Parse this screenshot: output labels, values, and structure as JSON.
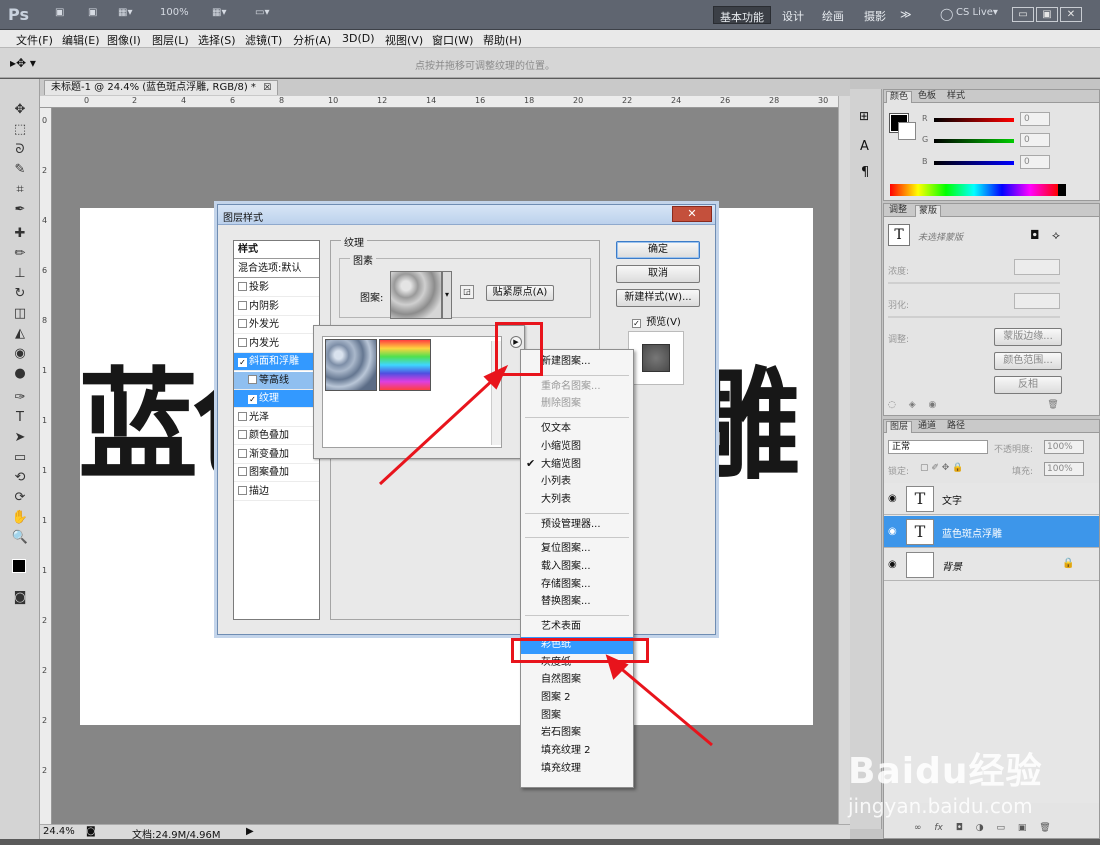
{
  "app": {
    "logo": "Ps",
    "zoom_display": "100%",
    "workspaces": [
      "基本功能",
      "设计",
      "绘画",
      "摄影",
      "≫"
    ],
    "cslive": "CS Live▾"
  },
  "menu": [
    "文件(F)",
    "编辑(E)",
    "图像(I)",
    "图层(L)",
    "选择(S)",
    "滤镜(T)",
    "分析(A)",
    "3D(D)",
    "视图(V)",
    "窗口(W)",
    "帮助(H)"
  ],
  "options_hint": "点按并拖移可调整纹理的位置。",
  "doc_tab": "未标题-1 @ 24.4% (蓝色斑点浮雕, RGB/8) *",
  "canvas_text": {
    "left": "蓝",
    "left2": "色",
    "right": "雕"
  },
  "ruler_h": [
    "0",
    "2",
    "4",
    "6",
    "8",
    "10",
    "12",
    "14",
    "16",
    "18",
    "20",
    "22",
    "24",
    "26",
    "28",
    "30"
  ],
  "ruler_v": [
    "0",
    "2",
    "4",
    "6",
    "8",
    "1",
    "1",
    "1",
    "1",
    "1",
    "2",
    "2",
    "2",
    "2"
  ],
  "status": {
    "zoom": "24.4%",
    "doc": "文档:24.9M/4.96M"
  },
  "color_panel": {
    "tabs": [
      "颜色",
      "色板",
      "样式"
    ],
    "channels": [
      {
        "label": "R",
        "value": "0",
        "color": "#e0141c"
      },
      {
        "label": "G",
        "value": "0",
        "color": "#19b41e"
      },
      {
        "label": "B",
        "value": "0",
        "color": "#1e3cd2"
      }
    ]
  },
  "adjust_panel": {
    "tabs": [
      "调整",
      "蒙版"
    ],
    "no_mask": "未选择蒙版",
    "density": "浓度:",
    "feather": "羽化:",
    "refine": "调整:",
    "btn_edge": "蒙版边缘...",
    "btn_range": "颜色范围...",
    "btn_invert": "反相"
  },
  "layers_panel": {
    "tabs": [
      "图层",
      "通道",
      "路径"
    ],
    "blend": "正常",
    "opacity_label": "不透明度:",
    "opacity": "100%",
    "lock_label": "锁定:",
    "fill_label": "填充:",
    "fill": "100%",
    "layers": [
      {
        "name": "文字",
        "thumb": "T"
      },
      {
        "name": "蓝色斑点浮雕",
        "thumb": "T"
      },
      {
        "name": "背景",
        "thumb": ""
      }
    ],
    "footer": "fx"
  },
  "dialog": {
    "title": "图层样式",
    "close": "✕",
    "styles_header": "样式",
    "blend_default": "混合选项:默认",
    "styles": [
      {
        "label": "投影",
        "checked": false,
        "indent": 0
      },
      {
        "label": "内阴影",
        "checked": false,
        "indent": 0
      },
      {
        "label": "外发光",
        "checked": false,
        "indent": 0
      },
      {
        "label": "内发光",
        "checked": false,
        "indent": 0
      },
      {
        "label": "斜面和浮雕",
        "checked": true,
        "indent": 0
      },
      {
        "label": "等高线",
        "checked": false,
        "indent": 1
      },
      {
        "label": "纹理",
        "checked": true,
        "indent": 1
      },
      {
        "label": "光泽",
        "checked": false,
        "indent": 0
      },
      {
        "label": "颜色叠加",
        "checked": false,
        "indent": 0
      },
      {
        "label": "渐变叠加",
        "checked": false,
        "indent": 0
      },
      {
        "label": "图案叠加",
        "checked": false,
        "indent": 0
      },
      {
        "label": "描边",
        "checked": false,
        "indent": 0
      }
    ],
    "group_texture": "纹理",
    "group_pattern": "图素",
    "pattern_label": "图案:",
    "snap_origin": "贴紧原点(A)",
    "ok": "确定",
    "cancel": "取消",
    "new_style": "新建样式(W)...",
    "preview": "预览(V)"
  },
  "flyout": [
    {
      "label": "新建图案...",
      "state": "normal"
    },
    {
      "sep": true
    },
    {
      "label": "重命名图案...",
      "state": "disabled"
    },
    {
      "label": "删除图案",
      "state": "disabled"
    },
    {
      "sep": true
    },
    {
      "label": "仅文本",
      "state": "normal"
    },
    {
      "label": "小缩览图",
      "state": "normal"
    },
    {
      "label": "大缩览图",
      "state": "checked"
    },
    {
      "label": "小列表",
      "state": "normal"
    },
    {
      "label": "大列表",
      "state": "normal"
    },
    {
      "sep": true
    },
    {
      "label": "预设管理器...",
      "state": "normal"
    },
    {
      "sep": true
    },
    {
      "label": "复位图案...",
      "state": "normal"
    },
    {
      "label": "载入图案...",
      "state": "normal"
    },
    {
      "label": "存储图案...",
      "state": "normal"
    },
    {
      "label": "替换图案...",
      "state": "normal"
    },
    {
      "sep": true
    },
    {
      "label": "艺术表面",
      "state": "normal"
    },
    {
      "label": "彩色纸",
      "state": "selected"
    },
    {
      "label": "灰度纸",
      "state": "normal"
    },
    {
      "label": "自然图案",
      "state": "normal"
    },
    {
      "label": "图案 2",
      "state": "normal"
    },
    {
      "label": "图案",
      "state": "normal"
    },
    {
      "label": "岩石图案",
      "state": "normal"
    },
    {
      "label": "填充纹理 2",
      "state": "normal"
    },
    {
      "label": "填充纹理",
      "state": "normal"
    }
  ],
  "watermark": {
    "brand": "Baidu经验",
    "url": "jingyan.baidu.com"
  },
  "colors": {
    "accent": "#3399ff",
    "annotation": "#e8141c",
    "titlebar": "#5f6570"
  }
}
